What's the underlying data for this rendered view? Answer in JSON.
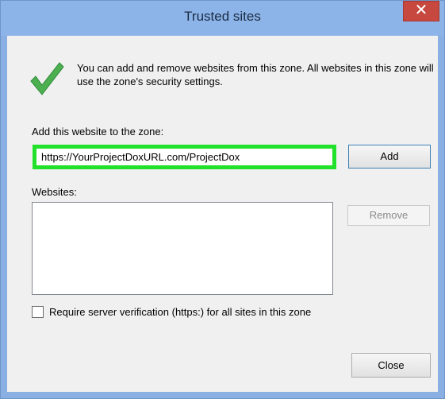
{
  "window": {
    "title": "Trusted sites",
    "close_glyph": "✕"
  },
  "info": {
    "icon": "checkmark-icon",
    "text": "You can add and remove websites from this zone. All websites in this zone will use the zone's security settings."
  },
  "add_section": {
    "label": "Add this website to the zone:",
    "url_value": "https://YourProjectDoxURL.com/ProjectDox",
    "add_button": "Add"
  },
  "websites_section": {
    "label": "Websites:",
    "items": [],
    "remove_button": "Remove"
  },
  "verification": {
    "checked": false,
    "label": "Require server verification (https:) for all sites in this zone"
  },
  "footer": {
    "close_button": "Close"
  },
  "colors": {
    "highlight_border": "#22e12a",
    "title_bar": "#8cb4e8",
    "close_button": "#c7483f"
  }
}
